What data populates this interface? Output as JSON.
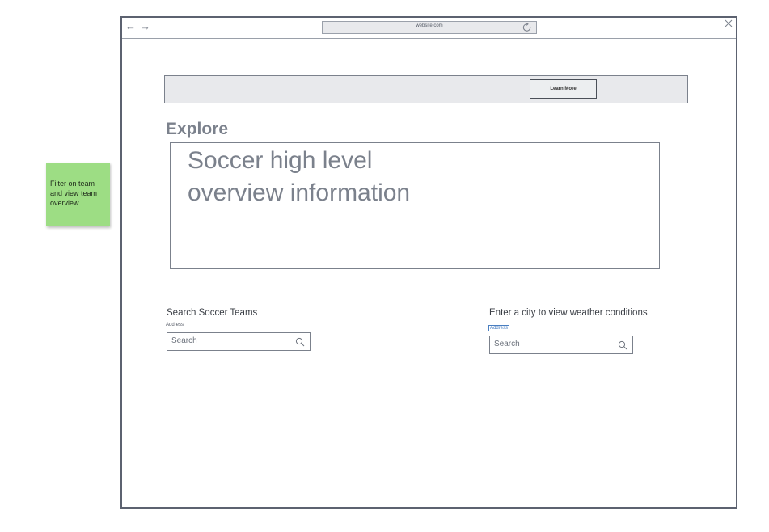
{
  "sticky_note": {
    "text": "Filter on team and view team overview"
  },
  "browser": {
    "url": "website.com",
    "back_icon": "←",
    "forward_icon": "→"
  },
  "banner": {
    "button_label": "Learn More"
  },
  "explore": {
    "heading": "Explore",
    "overview_line1": "Soccer high level",
    "overview_line2": "overview information"
  },
  "team_search": {
    "title": "Search Soccer Teams",
    "field_label": "Address",
    "placeholder": "Search"
  },
  "weather_search": {
    "title": "Enter a city to view weather conditions",
    "field_label": "Address",
    "placeholder": "Search"
  },
  "colors": {
    "sticky": "#9ddd84",
    "frame": "#5c6270",
    "muted_text": "#7b818c",
    "panel": "#e8e9ec"
  }
}
